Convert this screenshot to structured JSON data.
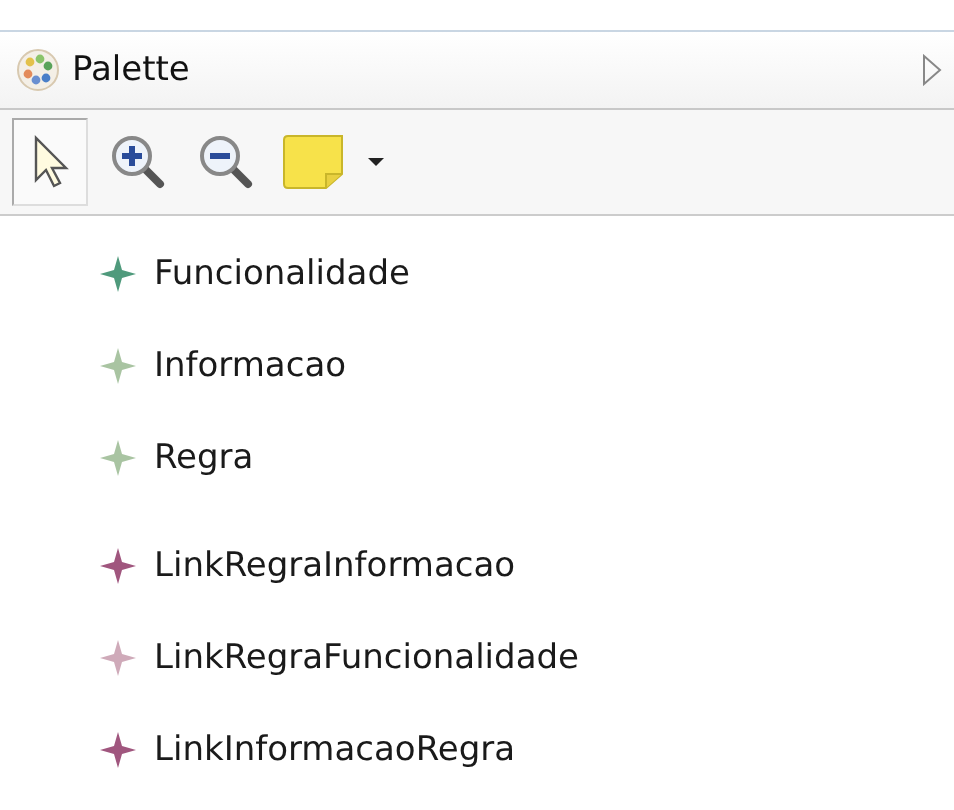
{
  "palette": {
    "title": "Palette"
  },
  "toolbar": [
    {
      "kind": "select",
      "selected": true
    },
    {
      "kind": "zoom-in",
      "selected": false
    },
    {
      "kind": "zoom-out",
      "selected": false
    },
    {
      "kind": "note",
      "selected": false
    }
  ],
  "groups": [
    {
      "items": [
        {
          "label": "Funcionalidade",
          "color": "#4f9a7c"
        },
        {
          "label": "Informacao",
          "color": "#a9c4a2"
        },
        {
          "label": "Regra",
          "color": "#a9c4a2"
        }
      ]
    },
    {
      "items": [
        {
          "label": "LinkRegraInformacao",
          "color": "#a0567e"
        },
        {
          "label": "LinkRegraFuncionalidade",
          "color": "#cfaab9"
        },
        {
          "label": "LinkInformacaoRegra",
          "color": "#a0567e"
        }
      ]
    }
  ]
}
